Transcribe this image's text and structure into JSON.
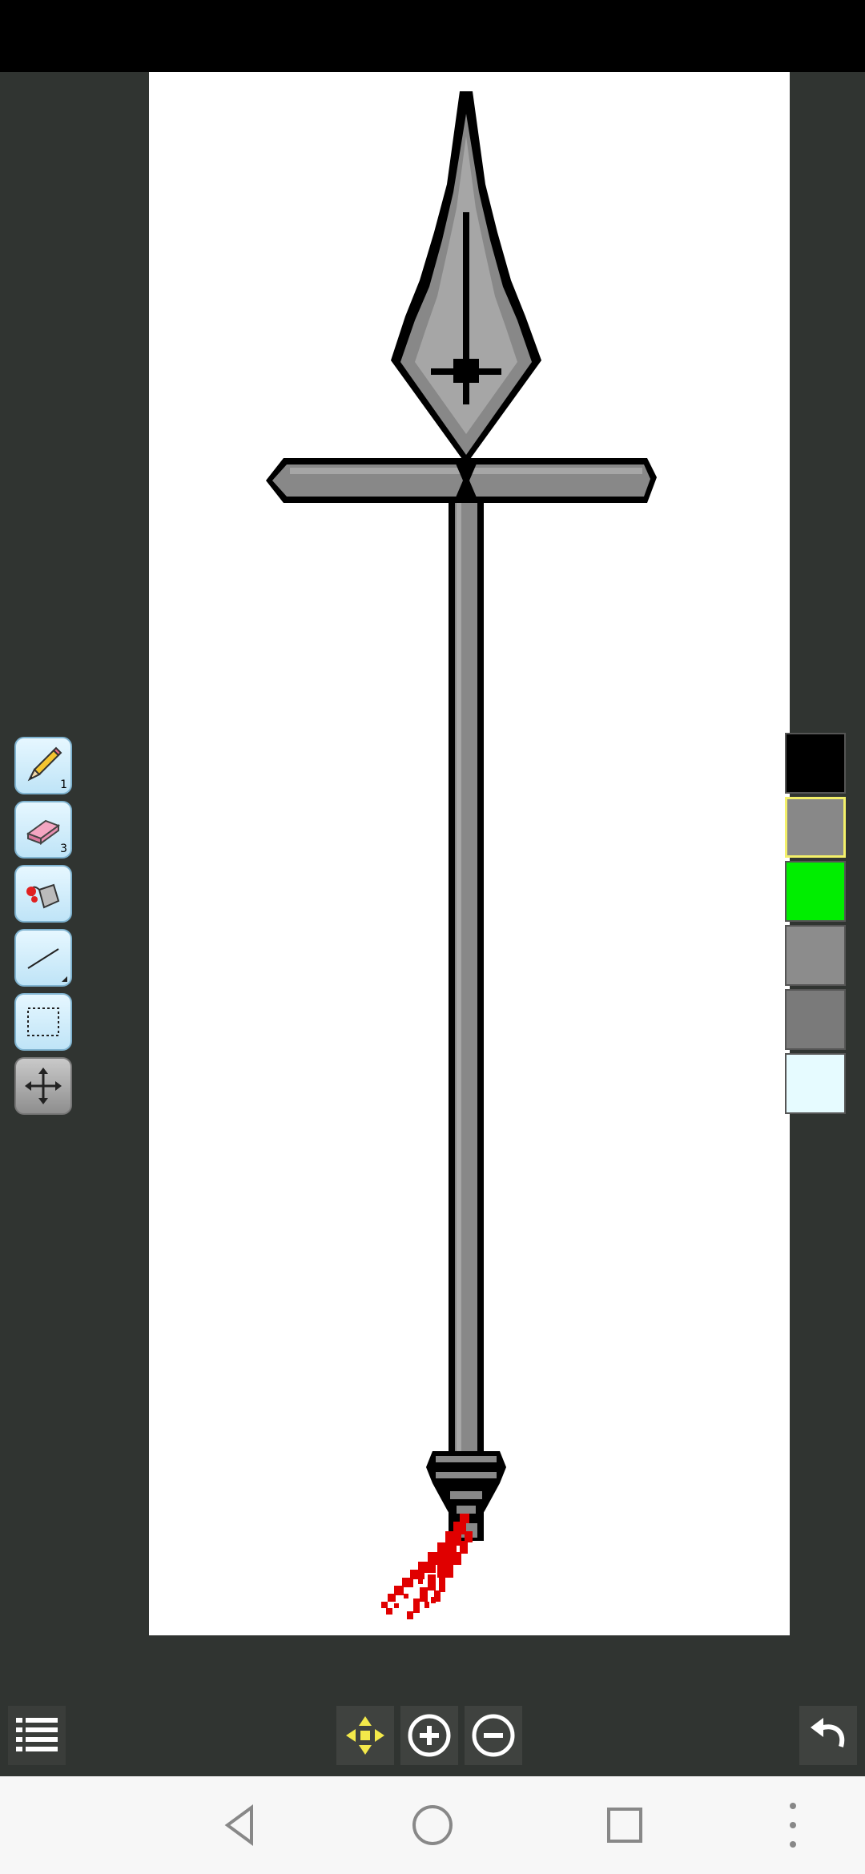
{
  "tools": {
    "pencil": {
      "name": "pencil",
      "size": "1"
    },
    "eraser": {
      "name": "eraser",
      "size": "3"
    },
    "fill": {
      "name": "paint-bucket"
    },
    "line": {
      "name": "line"
    },
    "select": {
      "name": "rectangle-select"
    },
    "move": {
      "name": "move"
    }
  },
  "palette": {
    "selected_index": 1,
    "colors": [
      "#000000",
      "#888888",
      "#00ee00",
      "#8c8c8c",
      "#7a7a7a",
      "#e6fbff"
    ]
  },
  "artwork": {
    "subject": "pixel-art spear",
    "colors": {
      "outline": "#000000",
      "metal": "#888888",
      "metal_light": "#a6a6a6",
      "blood": "#ee0000"
    }
  },
  "bottom_bar": {
    "menu_icon": "menu-icon",
    "pan_icon": "pan-icon",
    "zoom_in_icon": "zoom-in-icon",
    "zoom_out_icon": "zoom-out-icon",
    "undo_icon": "undo-icon"
  },
  "nav": {
    "back_icon": "back-icon",
    "home_icon": "home-icon",
    "recents_icon": "recents-icon",
    "more_icon": "more-icon"
  }
}
